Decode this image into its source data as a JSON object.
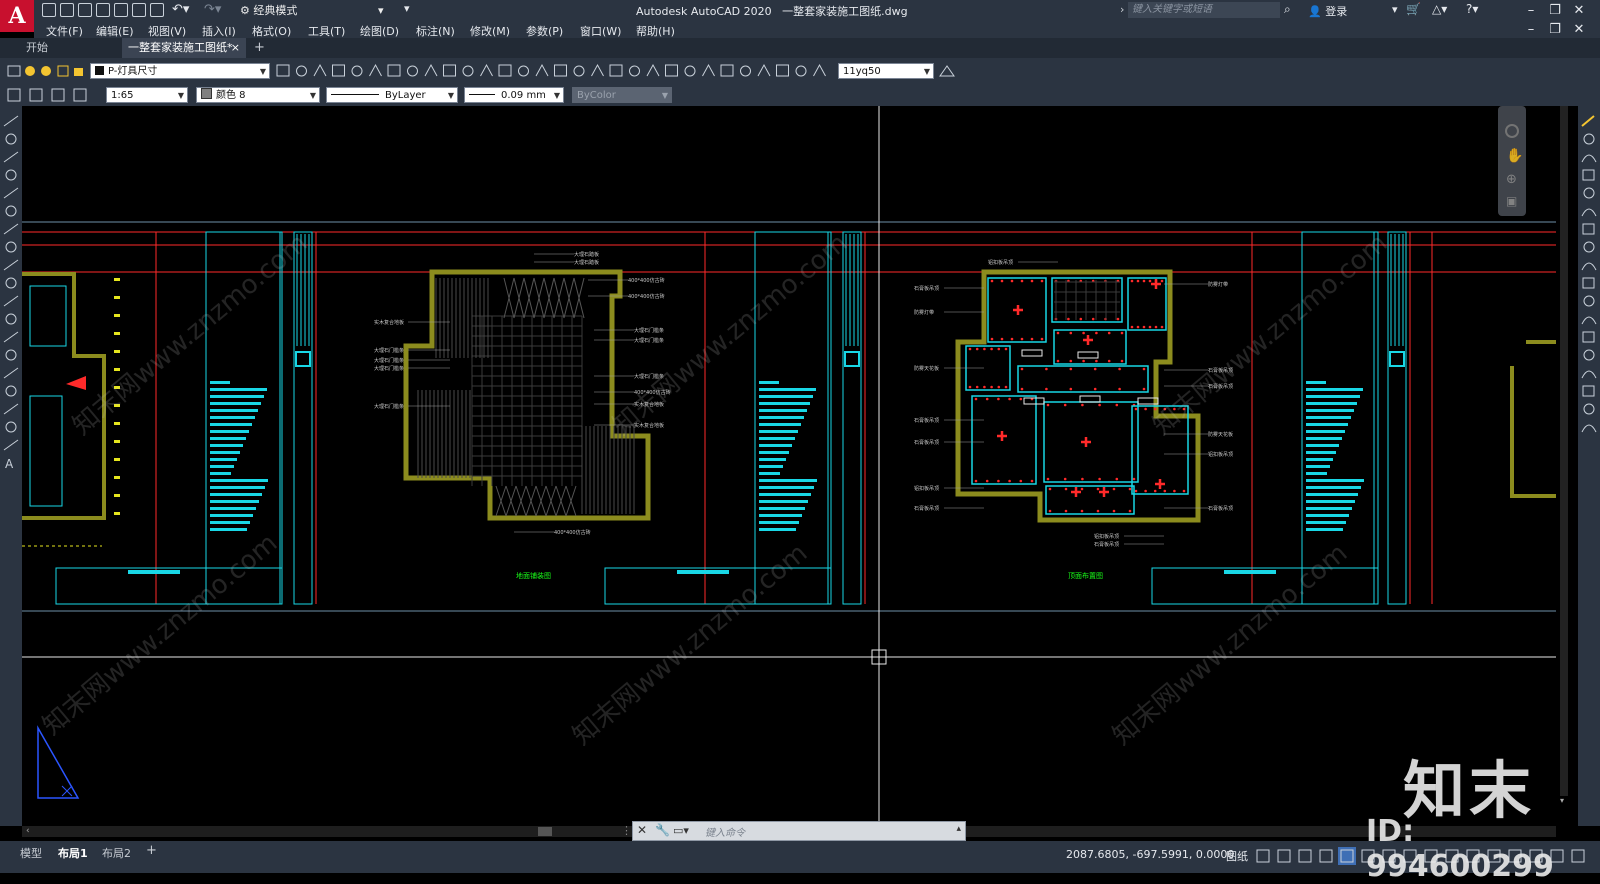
{
  "app": {
    "logo": "A",
    "title": "Autodesk AutoCAD 2020",
    "filename": "一整套家装施工图纸.dwg",
    "workspace": "经典模式",
    "search_placeholder": "键入关键字或短语",
    "login": "登录"
  },
  "menu": [
    "文件(F)",
    "编辑(E)",
    "视图(V)",
    "插入(I)",
    "格式(O)",
    "工具(T)",
    "绘图(D)",
    "标注(N)",
    "修改(M)",
    "参数(P)",
    "窗口(W)",
    "帮助(H)"
  ],
  "tabs": {
    "start": "开始",
    "file": "一整套家装施工图纸*",
    "close": "×",
    "add": "+"
  },
  "toolbar": {
    "layer": "P-灯具尺寸",
    "dimstyle": "11yq50",
    "scale": "1:65",
    "color": "颜色 8",
    "linetype": "ByLayer",
    "lineweight": "0.09 mm",
    "plotstyle": "ByColor"
  },
  "layout_tabs": [
    "模型",
    "布局1",
    "布局2"
  ],
  "layout_add": "+",
  "command_placeholder": "键入命令",
  "status": {
    "coords": "2087.6805, -697.5991, 0.0000",
    "paper": "图纸"
  },
  "drawing": {
    "sheet_titles": [
      "地面铺装图",
      "顶面布置图"
    ],
    "floor_labels": [
      "大理石踏板",
      "大理石踏板",
      "400*400仿古砖",
      "400*400仿古砖",
      "实木复合地板",
      "大理石门槛条",
      "大理石门槛条",
      "大理石门槛条",
      "大理石门槛条",
      "大理石门槛条",
      "大理石门槛条",
      "400*400仿古砖",
      "实木复合地板",
      "实木复合地板",
      "大理石门槛条",
      "400*400仿古砖"
    ],
    "ceiling_labels": [
      "铝扣板吊顶",
      "石膏板吊顶",
      "防雾灯带",
      "防雾灯带",
      "石膏板吊顶",
      "石膏板吊顶",
      "防雾天花板",
      "石膏板吊顶",
      "石膏板吊顶",
      "铝扣板吊顶",
      "石膏板吊顶",
      "铝扣板吊顶",
      "石膏板吊顶",
      "防雾天花板",
      "铝扣板吊顶",
      "石膏板吊顶"
    ]
  },
  "watermark": {
    "text": "知末",
    "id": "ID: 994600299",
    "diag": "知末网www.znzmo.com"
  },
  "colors": {
    "red": "#ff2a2a",
    "cyan": "#19d7e6",
    "olive": "#8c8c1e",
    "yellow": "#e6e61e",
    "green": "#19ff19",
    "frame": "#6e8fa8"
  }
}
